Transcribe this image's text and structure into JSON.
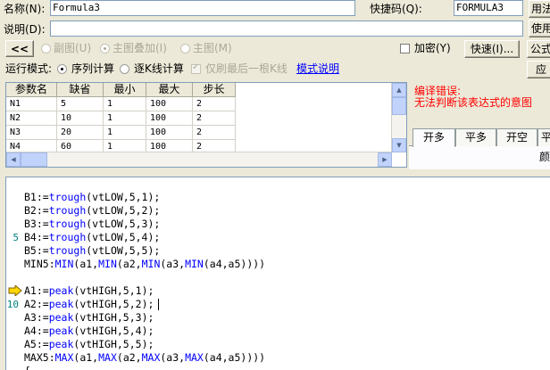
{
  "form": {
    "name_label": "名称(N):",
    "name_value": "Formula3",
    "shortcut_label": "快捷码(Q):",
    "shortcut_value": "FORMULA3",
    "apply_btn": "用法",
    "desc_label": "说明(D):",
    "desc_value": "",
    "use_btn": "使用",
    "nav_btn": "<<",
    "radio_sub": "副图(U)",
    "radio_main_overlay": "主图叠加(I)",
    "radio_main": "主图(M)",
    "encrypt_label": "加密(Y)",
    "quick_btn": "快速(I)...",
    "formula_btn": "公式",
    "run_mode_label": "运行模式:",
    "run_seq": "序列计算",
    "run_step": "逐K线计算",
    "last_only": "仅刷最后一根K线",
    "mode_help": "模式说明",
    "apply2_btn": "应"
  },
  "params": {
    "headers": [
      "参数名",
      "缺省",
      "最小",
      "最大",
      "步长"
    ],
    "rows": [
      [
        "N1",
        "5",
        "1",
        "100",
        "2"
      ],
      [
        "N2",
        "10",
        "1",
        "100",
        "2"
      ],
      [
        "N3",
        "20",
        "1",
        "100",
        "2"
      ],
      [
        "N4",
        "60",
        "1",
        "100",
        "2"
      ]
    ]
  },
  "error": {
    "title": "编译错误:",
    "message": "无法判断该表达式的意图"
  },
  "tabs": [
    "开多",
    "平多",
    "开空",
    "平"
  ],
  "tab_extra": "颜",
  "code": {
    "lines": [
      {
        "n": "",
        "t": ""
      },
      {
        "n": "",
        "t": "B1:=trough(vtLOW,5,1);"
      },
      {
        "n": "",
        "t": "B2:=trough(vtLOW,5,2);"
      },
      {
        "n": "",
        "t": "B3:=trough(vtLOW,5,3);"
      },
      {
        "n": "5",
        "t": "B4:=trough(vtLOW,5,4);"
      },
      {
        "n": "",
        "t": "B5:=trough(vtLOW,5,5);"
      },
      {
        "n": "",
        "t": "MIN5:MIN(a1,MIN(a2,MIN(a3,MIN(a4,a5))))"
      },
      {
        "n": "",
        "t": ""
      },
      {
        "n": "",
        "t": "A1:=peak(vtHIGH,5,1);"
      },
      {
        "n": "10",
        "t": "A2:=peak(vtHIGH,5,2);"
      },
      {
        "n": "",
        "t": "A3:=peak(vtHIGH,5,3);"
      },
      {
        "n": "",
        "t": "A4:=peak(vtHIGH,5,4);"
      },
      {
        "n": "",
        "t": "A5:=peak(vtHIGH,5,5);"
      },
      {
        "n": "",
        "t": "MAX5:MAX(a1,MAX(a2,MAX(a3,MAX(a4,a5))))"
      },
      {
        "n": "",
        "t": "{"
      }
    ]
  },
  "colors": {
    "error_text": "#ff0000",
    "function_name": "#0000ff",
    "link": "#0000ff",
    "arrow_marker": "#ffd700"
  }
}
